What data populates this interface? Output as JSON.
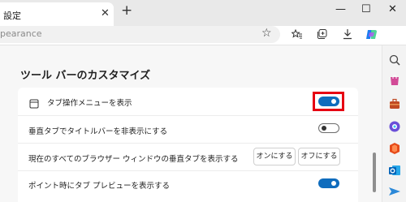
{
  "tab": {
    "title": "設定",
    "close_glyph": "✕"
  },
  "newtab_glyph": "+",
  "window": {
    "minimize": "—",
    "maximize": "☐",
    "close": "✕"
  },
  "address": {
    "text": "pearance"
  },
  "toolbar_icons": [
    "star-icon",
    "favorites-icon",
    "collections-icon",
    "download-icon",
    "copilot-icon"
  ],
  "sidebar_icons": [
    "search-icon",
    "shopping-icon",
    "tools-icon",
    "games-icon",
    "office-icon",
    "outlook-icon",
    "send-icon"
  ],
  "section": {
    "title": "ツール バーのカスタマイズ"
  },
  "rows": [
    {
      "label": "タブ操作メニューを表示",
      "toggle": "on",
      "highlighted": true
    },
    {
      "label": "垂直タブでタイトルバーを非表示にする",
      "toggle": "off"
    },
    {
      "label": "現在のすべてのブラウザー ウィンドウの垂直タブを表示する",
      "buttons": [
        "オンにする",
        "オフにする"
      ]
    },
    {
      "label": "ポイント時にタブ プレビューを表示する",
      "toggle": "on"
    }
  ],
  "colors": {
    "accent": "#0f6cbd",
    "highlight": "#e60012"
  }
}
